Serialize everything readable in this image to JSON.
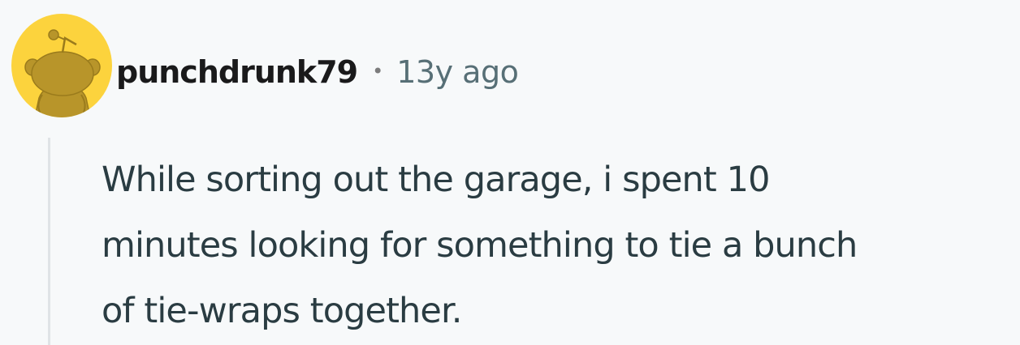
{
  "comment": {
    "author": "punchdrunk79",
    "separator": "•",
    "timestamp": "13y ago",
    "avatar_icon": "snoo-avatar-icon",
    "body_lines": [
      "While sorting out the garage, i spent 10",
      "minutes looking for something to tie a bunch",
      "of tie-wraps together."
    ]
  },
  "colors": {
    "background": "#f7f9fa",
    "avatar_bg": "#fcd33d",
    "avatar_figure": "#b8952a",
    "username": "#1a1a1b",
    "timestamp": "#576f76",
    "body_text": "#2a3c42",
    "thread_line": "#dfe3e6"
  }
}
